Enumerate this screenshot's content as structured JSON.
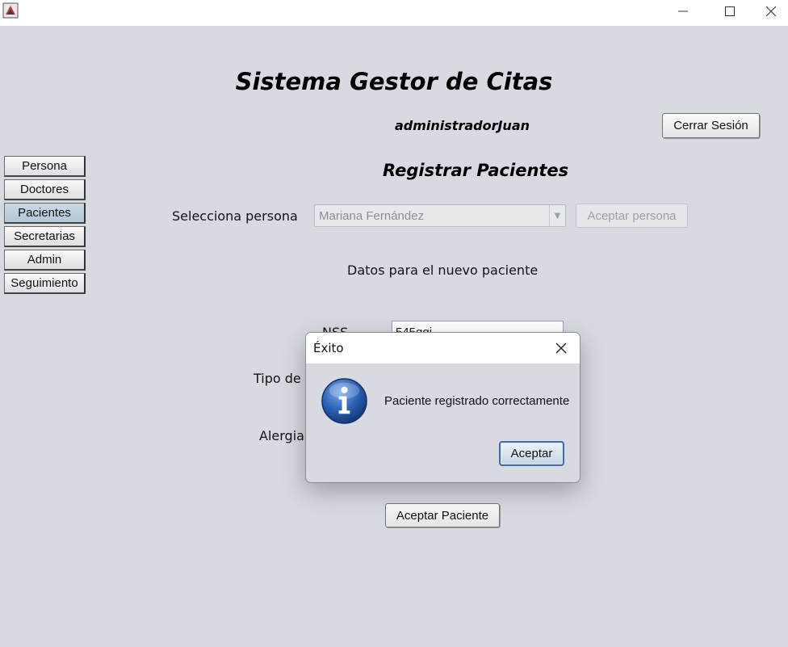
{
  "window": {
    "minimize_icon": "minimize-icon",
    "maximize_icon": "maximize-icon",
    "close_icon": "close-icon"
  },
  "header": {
    "title": "Sistema Gestor de Citas",
    "username": "administradorJuan",
    "logout_label": "Cerrar Sesión"
  },
  "nav": {
    "items": [
      {
        "label": "Persona",
        "active": false
      },
      {
        "label": "Doctores",
        "active": false
      },
      {
        "label": "Pacientes",
        "active": true
      },
      {
        "label": "Secretarias",
        "active": false
      },
      {
        "label": "Admin",
        "active": false
      },
      {
        "label": "Seguimiento",
        "active": false
      }
    ]
  },
  "form": {
    "section_title": "Registrar Pacientes",
    "select_person_label": "Selecciona persona",
    "select_person_value": "Mariana Fernández",
    "accept_person_label": "Aceptar persona",
    "new_patient_heading": "Datos para el nuevo paciente",
    "nss_label": "NSS",
    "nss_value": "545ggj",
    "blood_type_label_visible": "Tipo de",
    "allergies_label_visible": "Alergias",
    "accept_patient_label": "Aceptar Paciente"
  },
  "dialog": {
    "title": "Éxito",
    "message": "Paciente registrado correctamente",
    "ok_label": "Aceptar",
    "icon": "info-icon"
  },
  "colors": {
    "background": "#d7dae1",
    "active_nav": "#b9cde0",
    "dialog_ok_border": "#3c6fa9",
    "info_icon_blue": "#2a5fb3"
  }
}
